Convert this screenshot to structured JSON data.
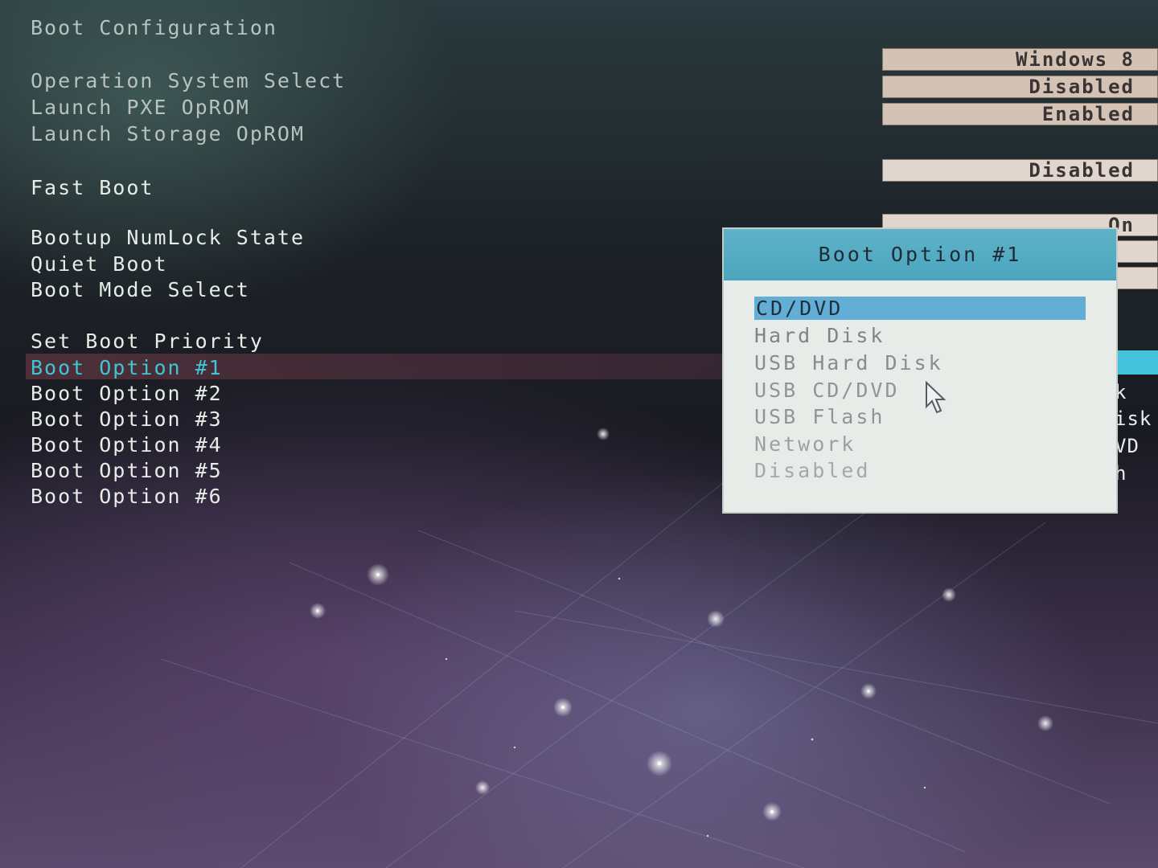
{
  "left_panel": {
    "title": "Boot Configuration",
    "items": [
      {
        "label": "Operation System Select"
      },
      {
        "label": "Launch PXE OpROM"
      },
      {
        "label": "Launch Storage OpROM"
      },
      {
        "label": "Fast Boot"
      },
      {
        "label": "Bootup NumLock State"
      },
      {
        "label": "Quiet Boot"
      },
      {
        "label": "Boot Mode Select"
      },
      {
        "label": "Set Boot Priority"
      },
      {
        "label": "Boot Option #1"
      },
      {
        "label": "Boot Option #2"
      },
      {
        "label": "Boot Option #3"
      },
      {
        "label": "Boot Option #4"
      },
      {
        "label": "Boot Option #5"
      },
      {
        "label": "Boot Option #6"
      }
    ]
  },
  "values": {
    "operation_system_select": "Windows 8",
    "launch_pxe_oprom": "Disabled",
    "launch_storage_oprom": "Enabled",
    "fast_boot": "Disabled",
    "bootup_numlock_state": "On"
  },
  "right_fragments": [
    "k",
    "isk",
    "VD",
    "h"
  ],
  "popup": {
    "title": "Boot Option #1",
    "options": [
      "CD/DVD",
      "Hard Disk",
      "USB Hard Disk",
      "USB CD/DVD",
      "USB Flash",
      "Network",
      "Disabled"
    ],
    "selected": "CD/DVD"
  },
  "colors": {
    "selected_text": "#3fc6d6",
    "popup_header": "#4aa6be",
    "option_highlight": "#63aed6",
    "value_box": "#d4c2b4"
  }
}
